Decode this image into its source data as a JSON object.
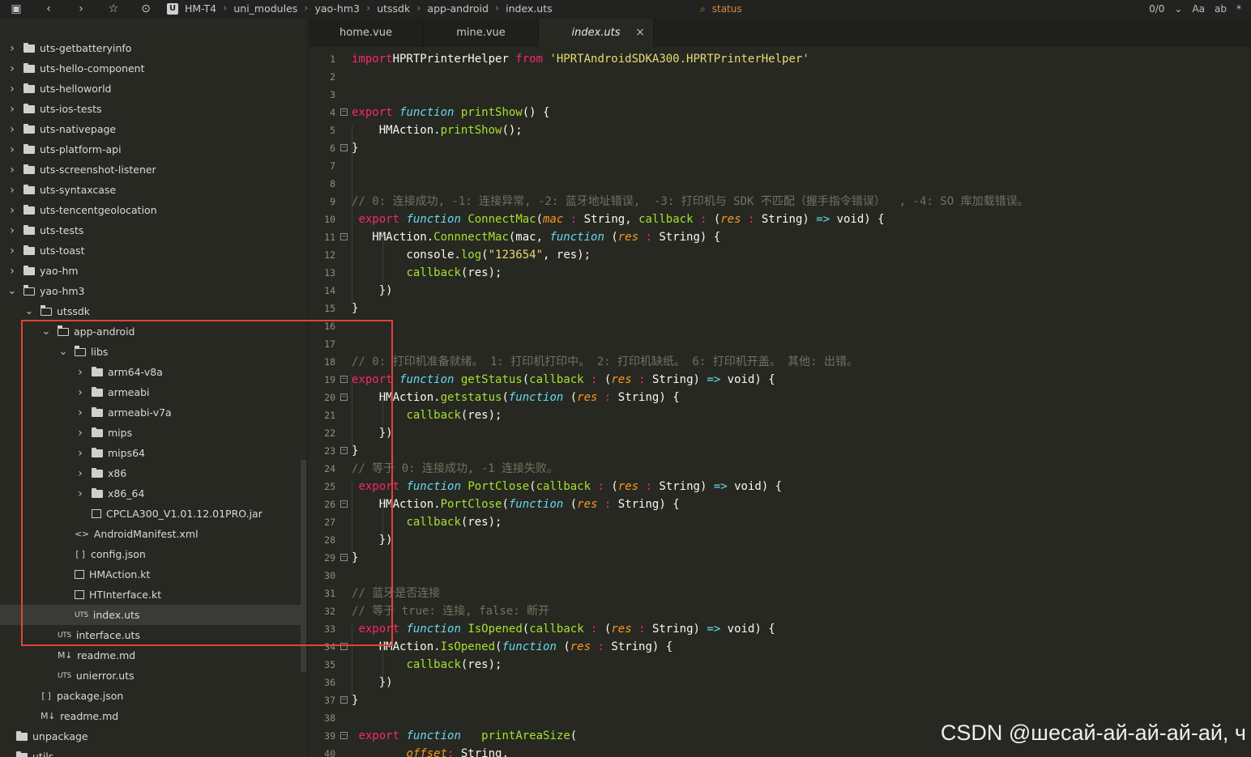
{
  "toolbar": {
    "icons": [
      "save-icon",
      "back-icon",
      "forward-icon",
      "star-icon",
      "run-icon"
    ],
    "breadcrumb": [
      "HM-T4",
      "uni_modules",
      "yao-hm3",
      "utssdk",
      "app-android",
      "index.uts"
    ],
    "logo_letter": "U",
    "search_text": "status",
    "match_count": "0/0",
    "case_label": "Aa",
    "word_label": "ab",
    "regex_label": "*"
  },
  "sidebar": {
    "rows": [
      {
        "label": "uts-getbatteryinfo",
        "indent": 0,
        "chevron": ">",
        "icon": "folder"
      },
      {
        "label": "uts-hello-component",
        "indent": 0,
        "chevron": ">",
        "icon": "folder"
      },
      {
        "label": "uts-helloworld",
        "indent": 0,
        "chevron": ">",
        "icon": "folder"
      },
      {
        "label": "uts-ios-tests",
        "indent": 0,
        "chevron": ">",
        "icon": "folder"
      },
      {
        "label": "uts-nativepage",
        "indent": 0,
        "chevron": ">",
        "icon": "folder"
      },
      {
        "label": "uts-platform-api",
        "indent": 0,
        "chevron": ">",
        "icon": "folder"
      },
      {
        "label": "uts-screenshot-listener",
        "indent": 0,
        "chevron": ">",
        "icon": "folder"
      },
      {
        "label": "uts-syntaxcase",
        "indent": 0,
        "chevron": ">",
        "icon": "folder"
      },
      {
        "label": "uts-tencentgeolocation",
        "indent": 0,
        "chevron": ">",
        "icon": "folder"
      },
      {
        "label": "uts-tests",
        "indent": 0,
        "chevron": ">",
        "icon": "folder"
      },
      {
        "label": "uts-toast",
        "indent": 0,
        "chevron": ">",
        "icon": "folder"
      },
      {
        "label": "yao-hm",
        "indent": 0,
        "chevron": ">",
        "icon": "folder"
      },
      {
        "label": "yao-hm3",
        "indent": 0,
        "chevron": "v",
        "icon": "folder-open"
      },
      {
        "label": "utssdk",
        "indent": 1,
        "chevron": "v",
        "icon": "folder-open"
      },
      {
        "label": "app-android",
        "indent": 2,
        "chevron": "v",
        "icon": "folder-open"
      },
      {
        "label": "libs",
        "indent": 3,
        "chevron": "v",
        "icon": "folder-open"
      },
      {
        "label": "arm64-v8a",
        "indent": 4,
        "chevron": ">",
        "icon": "folder"
      },
      {
        "label": "armeabi",
        "indent": 4,
        "chevron": ">",
        "icon": "folder"
      },
      {
        "label": "armeabi-v7a",
        "indent": 4,
        "chevron": ">",
        "icon": "folder"
      },
      {
        "label": "mips",
        "indent": 4,
        "chevron": ">",
        "icon": "folder"
      },
      {
        "label": "mips64",
        "indent": 4,
        "chevron": ">",
        "icon": "folder"
      },
      {
        "label": "x86",
        "indent": 4,
        "chevron": ">",
        "icon": "folder"
      },
      {
        "label": "x86_64",
        "indent": 4,
        "chevron": ">",
        "icon": "folder"
      },
      {
        "label": "CPCLA300_V1.01.12.01PRO.jar",
        "indent": 4,
        "chevron": "",
        "icon": "file"
      },
      {
        "label": "AndroidManifest.xml",
        "indent": 3,
        "chevron": "",
        "icon": "xml"
      },
      {
        "label": "config.json",
        "indent": 3,
        "chevron": "",
        "icon": "json"
      },
      {
        "label": "HMAction.kt",
        "indent": 3,
        "chevron": "",
        "icon": "file"
      },
      {
        "label": "HTInterface.kt",
        "indent": 3,
        "chevron": "",
        "icon": "file"
      },
      {
        "label": "index.uts",
        "indent": 3,
        "chevron": "",
        "icon": "uts",
        "selected": true
      },
      {
        "label": "interface.uts",
        "indent": 2,
        "chevron": "",
        "icon": "uts"
      },
      {
        "label": "readme.md",
        "indent": 2,
        "chevron": "",
        "icon": "md"
      },
      {
        "label": "unierror.uts",
        "indent": 2,
        "chevron": "",
        "icon": "uts"
      },
      {
        "label": "package.json",
        "indent": 1,
        "chevron": "",
        "icon": "json"
      },
      {
        "label": "readme.md",
        "indent": 1,
        "chevron": "",
        "icon": "md"
      },
      {
        "label": "unpackage",
        "indent": -1,
        "chevron": "",
        "icon": "folder"
      },
      {
        "label": "utils",
        "indent": -1,
        "chevron": "",
        "icon": "folder"
      }
    ],
    "icon_glyphs": {
      "uts": "UTS",
      "md": "M↓",
      "json": "[ ]",
      "xml": "<>"
    }
  },
  "tabs": [
    {
      "label": "home.vue",
      "active": false
    },
    {
      "label": "mine.vue",
      "active": false
    },
    {
      "label": "index.uts",
      "active": true,
      "close": "×"
    }
  ],
  "editor": {
    "lines": [
      {
        "n": "1",
        "segs": [
          [
            "kw",
            "import"
          ],
          [
            "",
            "HPRTPrinterHelper "
          ],
          [
            "kw",
            "from"
          ],
          [
            "",
            " "
          ],
          [
            "st",
            "'HPRTAndroidSDKA300.HPRTPrinterHelper'"
          ]
        ]
      },
      {
        "n": "2",
        "segs": []
      },
      {
        "n": "3",
        "segs": []
      },
      {
        "n": "4",
        "fold": "−",
        "segs": [
          [
            "kw",
            "export "
          ],
          [
            "fn",
            "function "
          ],
          [
            "nm",
            "printShow"
          ],
          [
            "",
            "() {"
          ]
        ]
      },
      {
        "n": "5",
        "segs": [
          [
            "",
            "    HMAction."
          ],
          [
            "nm",
            "printShow"
          ],
          [
            "",
            "();"
          ]
        ]
      },
      {
        "n": "6",
        "fold": "−",
        "segs": [
          [
            "",
            "}"
          ]
        ]
      },
      {
        "n": "7",
        "segs": []
      },
      {
        "n": "8",
        "segs": []
      },
      {
        "n": "9",
        "segs": [
          [
            "cm",
            "// 0: 连接成功, -1: 连接异常, -2: 蓝牙地址错误,  -3: 打印机与 SDK 不匹配（握手指令错误）  , -4: SO 库加载错误。"
          ]
        ]
      },
      {
        "n": "10",
        "segs": [
          [
            "",
            " "
          ],
          [
            "kw",
            "export "
          ],
          [
            "fn",
            "function "
          ],
          [
            "nm",
            "ConnectMac"
          ],
          [
            "",
            "("
          ],
          [
            "pa",
            "mac"
          ],
          [
            "kw",
            " : "
          ],
          [
            "",
            "String, "
          ],
          [
            "nm",
            "callback"
          ],
          [
            "kw",
            " : "
          ],
          [
            "",
            "("
          ],
          [
            "pa",
            "res"
          ],
          [
            "kw",
            " : "
          ],
          [
            "",
            "String) "
          ],
          [
            "fn",
            "=>"
          ],
          [
            "",
            " void) {"
          ]
        ]
      },
      {
        "n": "11",
        "fold": "−",
        "segs": [
          [
            "",
            "   HMAction."
          ],
          [
            "nm",
            "ConnnectMac"
          ],
          [
            "",
            "(mac, "
          ],
          [
            "fn",
            "function"
          ],
          [
            "",
            " ("
          ],
          [
            "pa",
            "res"
          ],
          [
            "kw",
            " : "
          ],
          [
            "",
            "String) {"
          ]
        ]
      },
      {
        "n": "12",
        "segs": [
          [
            "",
            "        console."
          ],
          [
            "nm",
            "log"
          ],
          [
            "",
            "("
          ],
          [
            "st",
            "\"123654\""
          ],
          [
            "",
            ", res);"
          ]
        ]
      },
      {
        "n": "13",
        "segs": [
          [
            "",
            "        "
          ],
          [
            "nm",
            "callback"
          ],
          [
            "",
            "(res);"
          ]
        ]
      },
      {
        "n": "14",
        "segs": [
          [
            "",
            "    })"
          ]
        ]
      },
      {
        "n": "15",
        "segs": [
          [
            "",
            "}"
          ]
        ]
      },
      {
        "n": "16",
        "segs": []
      },
      {
        "n": "17",
        "segs": []
      },
      {
        "n": "18",
        "segs": [
          [
            "cm",
            "// 0: 打印机准备就绪。 1: 打印机打印中。 2: 打印机缺纸。 6: 打印机开盖。 其他: 出错。"
          ]
        ]
      },
      {
        "n": "19",
        "fold": "−",
        "segs": [
          [
            "kw",
            "export "
          ],
          [
            "fn",
            "function "
          ],
          [
            "nm",
            "getStatus"
          ],
          [
            "",
            "("
          ],
          [
            "nm",
            "callback"
          ],
          [
            "kw",
            " : "
          ],
          [
            "",
            "("
          ],
          [
            "pa",
            "res"
          ],
          [
            "kw",
            " : "
          ],
          [
            "",
            "String) "
          ],
          [
            "fn",
            "=>"
          ],
          [
            "",
            " void) {"
          ]
        ]
      },
      {
        "n": "20",
        "fold": "−",
        "segs": [
          [
            "",
            "    HMAction."
          ],
          [
            "nm",
            "getstatus"
          ],
          [
            "",
            "("
          ],
          [
            "fn",
            "function"
          ],
          [
            "",
            " ("
          ],
          [
            "pa",
            "res"
          ],
          [
            "kw",
            " : "
          ],
          [
            "",
            "String) {"
          ]
        ]
      },
      {
        "n": "21",
        "segs": [
          [
            "",
            "        "
          ],
          [
            "nm",
            "callback"
          ],
          [
            "",
            "(res);"
          ]
        ]
      },
      {
        "n": "22",
        "segs": [
          [
            "",
            "    })"
          ]
        ]
      },
      {
        "n": "23",
        "fold": "−",
        "segs": [
          [
            "",
            "}"
          ]
        ]
      },
      {
        "n": "24",
        "segs": [
          [
            "cm",
            "// 等于 0: 连接成功, -1 连接失败。"
          ]
        ]
      },
      {
        "n": "25",
        "segs": [
          [
            "",
            " "
          ],
          [
            "kw",
            "export "
          ],
          [
            "fn",
            "function "
          ],
          [
            "nm",
            "PortClose"
          ],
          [
            "",
            "("
          ],
          [
            "nm",
            "callback"
          ],
          [
            "kw",
            " : "
          ],
          [
            "",
            "("
          ],
          [
            "pa",
            "res"
          ],
          [
            "kw",
            " : "
          ],
          [
            "",
            "String) "
          ],
          [
            "fn",
            "=>"
          ],
          [
            "",
            " void) {"
          ]
        ]
      },
      {
        "n": "26",
        "fold": "−",
        "segs": [
          [
            "",
            "    HMAction."
          ],
          [
            "nm",
            "PortClose"
          ],
          [
            "",
            "("
          ],
          [
            "fn",
            "function"
          ],
          [
            "",
            " ("
          ],
          [
            "pa",
            "res"
          ],
          [
            "kw",
            " : "
          ],
          [
            "",
            "String) {"
          ]
        ]
      },
      {
        "n": "27",
        "segs": [
          [
            "",
            "        "
          ],
          [
            "nm",
            "callback"
          ],
          [
            "",
            "(res);"
          ]
        ]
      },
      {
        "n": "28",
        "segs": [
          [
            "",
            "    })"
          ]
        ]
      },
      {
        "n": "29",
        "fold": "−",
        "segs": [
          [
            "",
            "}"
          ]
        ]
      },
      {
        "n": "30",
        "segs": []
      },
      {
        "n": "31",
        "segs": [
          [
            "cm",
            "// 蓝牙是否连接"
          ]
        ]
      },
      {
        "n": "32",
        "segs": [
          [
            "cm",
            "// 等于 true: 连接, false: 断开"
          ]
        ]
      },
      {
        "n": "33",
        "segs": [
          [
            "",
            " "
          ],
          [
            "kw",
            "export "
          ],
          [
            "fn",
            "function "
          ],
          [
            "nm",
            "IsOpened"
          ],
          [
            "",
            "("
          ],
          [
            "nm",
            "callback"
          ],
          [
            "kw",
            " : "
          ],
          [
            "",
            "("
          ],
          [
            "pa",
            "res"
          ],
          [
            "kw",
            " : "
          ],
          [
            "",
            "String) "
          ],
          [
            "fn",
            "=>"
          ],
          [
            "",
            " void) {"
          ]
        ]
      },
      {
        "n": "34",
        "fold": "−",
        "segs": [
          [
            "",
            "    HMAction."
          ],
          [
            "nm",
            "IsOpened"
          ],
          [
            "",
            "("
          ],
          [
            "fn",
            "function"
          ],
          [
            "",
            " ("
          ],
          [
            "pa",
            "res"
          ],
          [
            "kw",
            " : "
          ],
          [
            "",
            "String) {"
          ]
        ]
      },
      {
        "n": "35",
        "segs": [
          [
            "",
            "        "
          ],
          [
            "nm",
            "callback"
          ],
          [
            "",
            "(res);"
          ]
        ]
      },
      {
        "n": "36",
        "segs": [
          [
            "",
            "    })"
          ]
        ]
      },
      {
        "n": "37",
        "fold": "−",
        "segs": [
          [
            "",
            "}"
          ]
        ]
      },
      {
        "n": "38",
        "segs": []
      },
      {
        "n": "39",
        "fold": "−",
        "segs": [
          [
            "",
            " "
          ],
          [
            "kw",
            "export "
          ],
          [
            "fn",
            "function "
          ],
          [
            "",
            "  "
          ],
          [
            "nm",
            "printAreaSize"
          ],
          [
            "",
            "("
          ]
        ]
      },
      {
        "n": "40",
        "segs": [
          [
            "",
            "        "
          ],
          [
            "pa",
            "offset"
          ],
          [
            "kw",
            ": "
          ],
          [
            "",
            "String,"
          ]
        ]
      }
    ]
  },
  "watermark": "CSDN @шесай-ай-ай-ай-ай, ч"
}
